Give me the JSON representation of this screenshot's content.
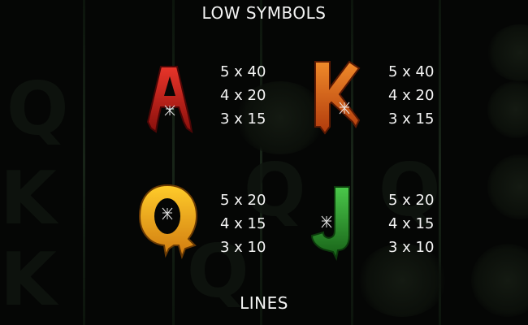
{
  "title": "LOW SYMBOLS",
  "footer_title": "LINES",
  "symbols": [
    {
      "letter": "A",
      "icon": "letter-a-red-icon",
      "color": "#c0211a",
      "pays": [
        "5 x 40",
        "4 x 20",
        "3 x 15"
      ]
    },
    {
      "letter": "K",
      "icon": "letter-k-orange-icon",
      "color": "#e0631a",
      "pays": [
        "5 x 40",
        "4 x 20",
        "3 x 15"
      ]
    },
    {
      "letter": "Q",
      "icon": "letter-q-yellow-icon",
      "color": "#f0a21c",
      "pays": [
        "5 x 20",
        "4 x 15",
        "3 x 10"
      ]
    },
    {
      "letter": "J",
      "icon": "letter-j-green-icon",
      "color": "#2a9a2a",
      "pays": [
        "5 x 20",
        "4 x 15",
        "3 x 10"
      ]
    }
  ]
}
